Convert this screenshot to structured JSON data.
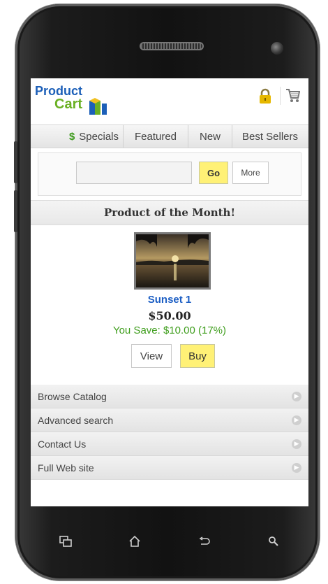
{
  "header": {
    "logo_line1": "Product",
    "logo_line2": "Cart"
  },
  "tabs": [
    {
      "label": "Specials"
    },
    {
      "label": "Featured"
    },
    {
      "label": "New"
    },
    {
      "label": "Best Sellers"
    }
  ],
  "search": {
    "placeholder": "",
    "go_label": "Go",
    "more_label": "More"
  },
  "product_of_month": {
    "heading": "Product of the Month!",
    "name": "Sunset 1",
    "price": "$50.00",
    "savings": "You Save: $10.00 (17%)",
    "view_label": "View",
    "buy_label": "Buy"
  },
  "menu": [
    {
      "label": "Browse Catalog"
    },
    {
      "label": "Advanced search"
    },
    {
      "label": "Contact Us"
    },
    {
      "label": "Full Web site"
    }
  ],
  "icons": {
    "lock": "lock-icon",
    "cart": "cart-icon",
    "specials": "dollar-icon",
    "nav": [
      "windows-icon",
      "home-icon",
      "back-icon",
      "search-icon"
    ]
  },
  "colors": {
    "accent_yellow": "#fff176",
    "link_blue": "#1d5fc4",
    "save_green": "#3f9e1d"
  }
}
